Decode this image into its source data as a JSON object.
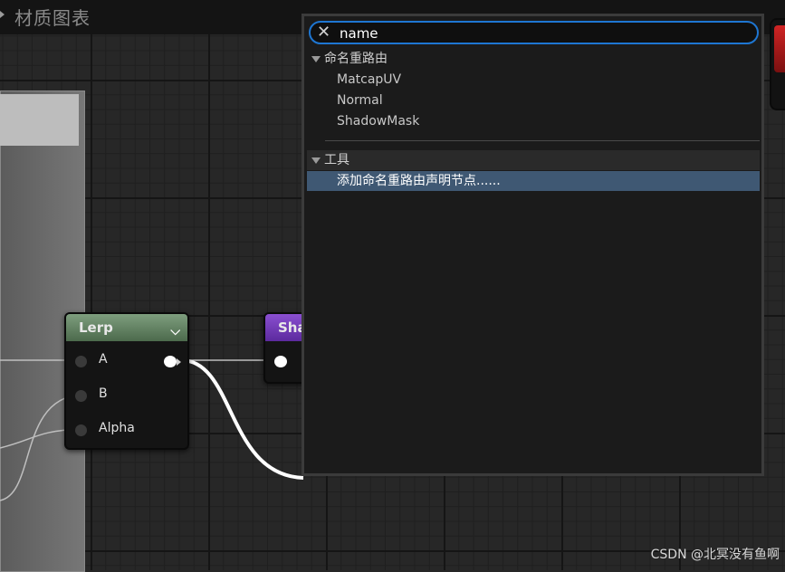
{
  "window": {
    "title": "材质图表"
  },
  "nodes": {
    "lerp": {
      "title": "Lerp",
      "pins": [
        "A",
        "B",
        "Alpha"
      ]
    },
    "shadow": {
      "title": "Sha"
    }
  },
  "popup": {
    "search": {
      "value": "name"
    },
    "categories": [
      {
        "label": "命名重路由",
        "items": [
          "MatcapUV",
          "Normal",
          "ShadowMask"
        ]
      },
      {
        "label": "工具",
        "items": [
          "添加命名重路由声明节点......"
        ]
      }
    ]
  },
  "watermark": "CSDN @北冥没有鱼啊",
  "colors": {
    "accent": "#1e76d2",
    "selection": "#3f5873",
    "lerp_header": "#6a8a6a",
    "shadow_header": "#7a3fc0"
  }
}
